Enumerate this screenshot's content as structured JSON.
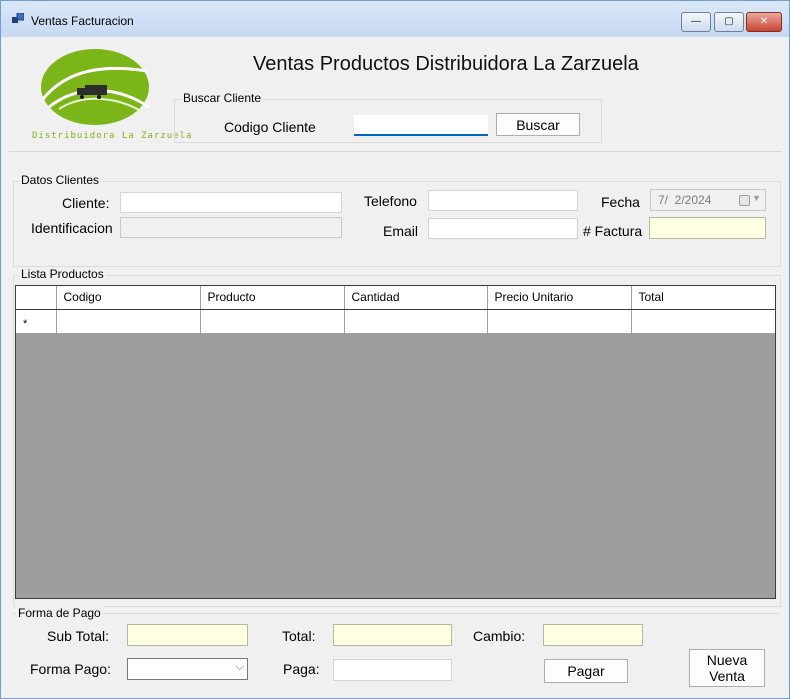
{
  "window": {
    "title": "Ventas Facturacion",
    "minimize": "—",
    "maximize": "▢",
    "close": "✕"
  },
  "logo": {
    "text": "Distribuidora La Zarzuela",
    "color": "#7cb518"
  },
  "header": {
    "title": "Ventas Productos Distribuidora La Zarzuela"
  },
  "buscar": {
    "group_label": "Buscar Cliente",
    "codigo_label": "Codigo Cliente",
    "codigo_value": "",
    "button": "Buscar"
  },
  "datos": {
    "group_label": "Datos Clientes",
    "cliente_label": "Cliente:",
    "identificacion_label": "Identificacion",
    "telefono_label": "Telefono",
    "email_label": "Email",
    "fecha_label": "Fecha",
    "fecha_value": "7/  2/2024",
    "factura_label": "# Factura",
    "cliente_value": "",
    "identificacion_value": "",
    "telefono_value": "",
    "email_value": "",
    "factura_value": ""
  },
  "productos": {
    "group_label": "Lista Productos",
    "columns": [
      "Codigo",
      "Producto",
      "Cantidad",
      "Precio Unitario",
      "Total"
    ],
    "new_row_marker": "*"
  },
  "pago": {
    "group_label": "Forma de Pago",
    "subtotal_label": "Sub Total:",
    "total_label": "Total:",
    "cambio_label": "Cambio:",
    "forma_label": "Forma Pago:",
    "paga_label": "Paga:",
    "pagar_button": "Pagar",
    "nueva_venta_line1": "Nueva",
    "nueva_venta_line2": "Venta",
    "forma_selected": "",
    "subtotal_value": "",
    "total_value": "",
    "cambio_value": "",
    "paga_value": ""
  },
  "colors": {
    "highlight_field": "#ffffe1",
    "grid_background": "#9e9e9e",
    "input_focus": "#0067c0"
  }
}
